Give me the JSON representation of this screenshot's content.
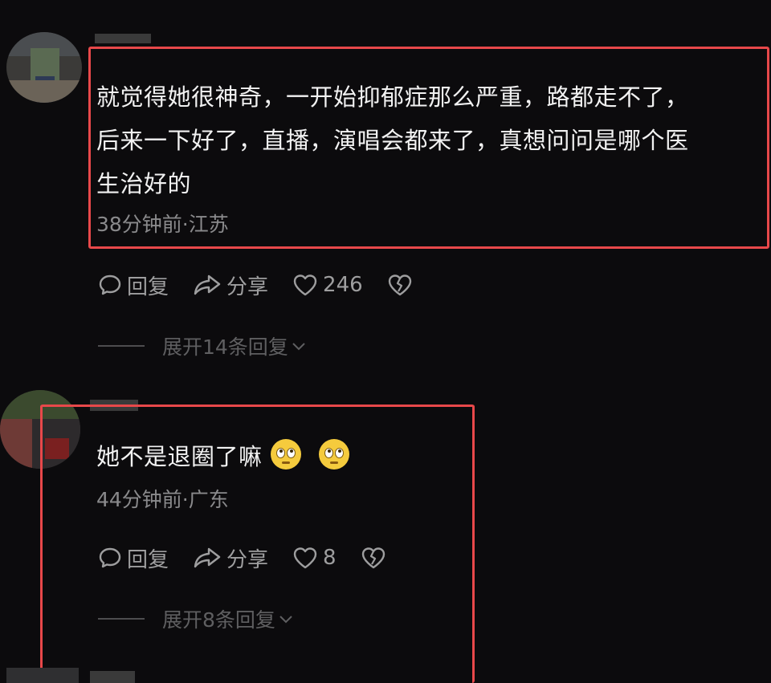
{
  "comments": [
    {
      "text": "就觉得她很神奇，一开始抑郁症那么严重，路都走不了，后来一下好了，直播，演唱会都来了，真想问问是哪个医生治好的",
      "lines": [
        "就觉得她很神奇，一开始抑郁症那么严重，路都走不了，",
        "后来一下好了，直播，演唱会都来了，真想问问是哪个医",
        "生治好的"
      ],
      "meta": "38分钟前·江苏",
      "reply_label": "回复",
      "share_label": "分享",
      "likes": "246",
      "expand_label": "展开14条回复"
    },
    {
      "text": "她不是退圈了嘛",
      "emoji": [
        "flushed-face-icon",
        "flushed-face-icon"
      ],
      "meta": "44分钟前·广东",
      "reply_label": "回复",
      "share_label": "分享",
      "likes": "8",
      "expand_label": "展开8条回复"
    }
  ],
  "colors": {
    "background": "#0c0b0d",
    "highlight": "#e8484a",
    "text": "#f2f2f2",
    "meta": "#8a8a8c"
  }
}
